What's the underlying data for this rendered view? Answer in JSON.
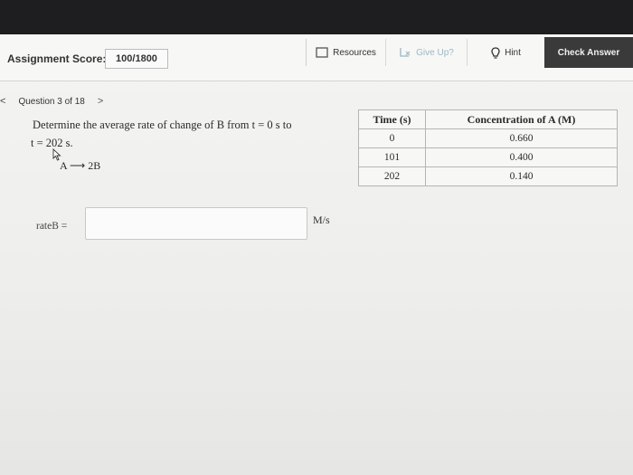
{
  "header": {
    "score_label": "Assignment Score:",
    "score_value": "100/1800",
    "resources_label": "Resources",
    "giveup_label": "Give Up?",
    "hint_label": "Hint",
    "check_label": "Check Answer"
  },
  "nav": {
    "question_label": "Question 3 of 18",
    "prev_glyph": "<",
    "next_glyph": ">"
  },
  "question": {
    "line1": "Determine the average rate of change of B from t = 0 s to",
    "line2": "t = 202 s.",
    "reaction": "A ⟶ 2B"
  },
  "answer": {
    "label": "rateB =",
    "value": "",
    "unit": "M/s"
  },
  "table": {
    "headers": [
      "Time (s)",
      "Concentration of A (M)"
    ],
    "rows": [
      [
        "0",
        "0.660"
      ],
      [
        "101",
        "0.400"
      ],
      [
        "202",
        "0.140"
      ]
    ]
  },
  "icons": {
    "resources": "document-icon",
    "giveup": "give-up-icon",
    "hint": "lightbulb-icon",
    "cursor": "mouse-cursor-icon"
  }
}
